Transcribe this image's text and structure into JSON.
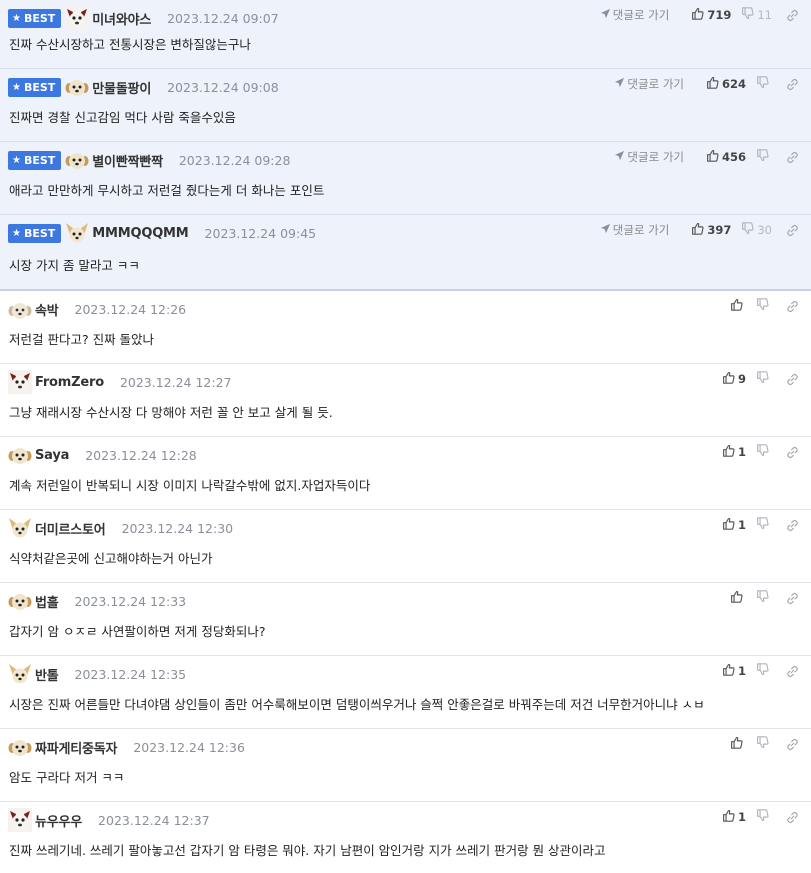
{
  "best_label": "BEST",
  "goto_label": "댓글로 가기",
  "comments": [
    {
      "best": true,
      "avatar": "dog-white",
      "nick": "미녀와야스",
      "date": "2023.12.24 09:07",
      "text": "진짜 수산시장하고 전통시장은 변하질않는구나",
      "up": "719",
      "down": "11",
      "goto": true
    },
    {
      "best": true,
      "avatar": "puppy",
      "nick": "만물돌팡이",
      "date": "2023.12.24 09:08",
      "text": "진짜면 경찰 신고감임 먹다 사람 죽을수있음",
      "up": "624",
      "down": "",
      "goto": true
    },
    {
      "best": true,
      "avatar": "puppy",
      "nick": "별이빤짝빤짝",
      "date": "2023.12.24 09:28",
      "text": "애라고 만만하게 무시하고 저런걸 줬다는게 더 화나는 포인트",
      "up": "456",
      "down": "",
      "goto": true
    },
    {
      "best": true,
      "avatar": "chihuahua",
      "nick": "MMMQQQMM",
      "date": "2023.12.24 09:45",
      "text": "시장 가지 좀 말라고 ㅋㅋ",
      "up": "397",
      "down": "30",
      "goto": true
    },
    {
      "best": false,
      "avatar": "puppy-grey",
      "nick": "속박",
      "date": "2023.12.24 12:26",
      "text": "저런걸 판다고? 진짜 돌았나",
      "up": "",
      "down": ""
    },
    {
      "best": false,
      "avatar": "dog-white",
      "nick": "FromZero",
      "date": "2023.12.24 12:27",
      "text": "그냥 재래시장 수산시장 다 망해야 저런 꼴 안 보고 살게 될 듯.",
      "up": "9",
      "down": ""
    },
    {
      "best": false,
      "avatar": "puppy",
      "nick": "Saya",
      "date": "2023.12.24 12:28",
      "text": "계속 저런일이 반복되니 시장 이미지 나락갈수밖에 없지.자업자득이다",
      "up": "1",
      "down": ""
    },
    {
      "best": false,
      "avatar": "chihuahua",
      "nick": "더미르스토어",
      "date": "2023.12.24 12:30",
      "text": "식약처같은곳에 신고해야하는거 아닌가",
      "up": "1",
      "down": ""
    },
    {
      "best": false,
      "avatar": "puppy",
      "nick": "법흘",
      "date": "2023.12.24 12:33",
      "text": "갑자기 암 ㅇㅈㄹ 사연팔이하면 저게 정당화되나?",
      "up": "",
      "down": ""
    },
    {
      "best": false,
      "avatar": "chihuahua",
      "nick": "반톨",
      "date": "2023.12.24 12:35",
      "text": "시장은 진짜 어른들만 다녀야댐 상인들이 좀만 어수룩해보이면 덤탱이씌우거나 슬쩍 안좋은걸로 바꿔주는데 저건 너무한거아니냐 ㅅㅂ",
      "up": "1",
      "down": ""
    },
    {
      "best": false,
      "avatar": "puppy",
      "nick": "짜파게티중독자",
      "date": "2023.12.24 12:36",
      "text": "암도 구라다 저거 ㅋㅋ",
      "up": "",
      "down": ""
    },
    {
      "best": false,
      "avatar": "dog-white",
      "nick": "뉴우우우",
      "date": "2023.12.24 12:37",
      "text": "진짜 쓰레기네. 쓰레기 팔아놓고선 갑자기 암 타령은 뭐야. 자기 남편이 암인거랑 지가 쓰레기 판거랑 뭔 상관이라고",
      "up": "1",
      "down": ""
    }
  ]
}
